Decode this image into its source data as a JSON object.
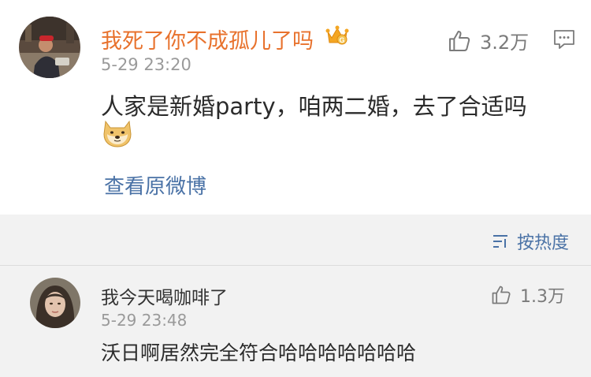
{
  "main_comment": {
    "username": "我死了你不成孤儿了吗",
    "timestamp": "5-29 23:20",
    "likes": "3.2万",
    "text": "人家是新婚party，咱两二婚，去了合适吗",
    "view_original": "查看原微博",
    "badge_icon": "vip-crown-icon",
    "emoji_icon": "doge-emoji"
  },
  "sort": {
    "label": "按热度",
    "icon": "sort-icon"
  },
  "reply": {
    "username": "我今天喝咖啡了",
    "timestamp": "5-29 23:48",
    "likes": "1.3万",
    "text": "沃日啊居然完全符合哈哈哈哈哈哈哈"
  },
  "colors": {
    "username_vip": "#e8722d",
    "username_normal": "#333333",
    "link": "#4a72a6",
    "timestamp": "#9a9a9a",
    "background": "#f2f2f2"
  }
}
